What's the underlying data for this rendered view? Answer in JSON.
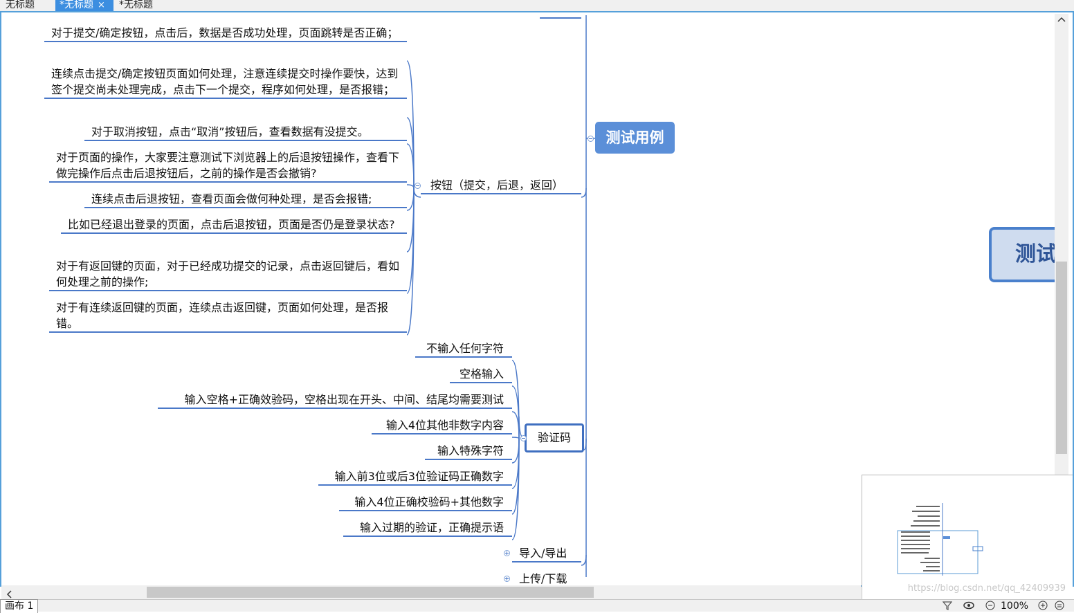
{
  "tabs": [
    {
      "label": "无标题"
    },
    {
      "label": "*无标题"
    },
    {
      "label": "*无标题"
    }
  ],
  "tab_close_glyph": "×",
  "mindmap": {
    "root": "测试",
    "topic": "测试用例",
    "button_branch": {
      "label": "按钮（提交，后退，返回）",
      "items": [
        "对于提交/确定按钮，点击后，数据是否成功处理，页面跳转是否正确；",
        "连续点击提交/确定按钮页面如何处理，注意连续提交时操作要快，达到签个提交尚未处理完成，点击下一个提交，程序如何处理，是否报错；",
        "对于取消按钮，点击“取消”按钮后，查看数据有没提交。",
        "对于页面的操作，大家要注意测试下浏览器上的后退按钮操作，查看下做完操作后点击后退按钮后，之前的操作是否会撤销?",
        "连续点击后退按钮，查看页面会做何种处理，是否会报错;",
        "比如已经退出登录的页面，点击后退按钮，页面是否仍是登录状态?",
        "对于有返回键的页面，对于已经成功提交的记录，点击返回键后，看如何处理之前的操作;",
        "对于有连续返回键的页面，连续点击返回键，页面如何处理，是否报错。"
      ]
    },
    "captcha_branch": {
      "label": "验证码",
      "items": [
        "不输入任何字符",
        "空格输入",
        "输入空格+正确效验码，空格出现在开头、中间、结尾均需要测试",
        "输入4位其他非数字内容",
        "输入特殊字符",
        "输入前3位或后3位验证码正确数字",
        "输入4位正确校验码+其他数字",
        "输入过期的验证，正确提示语"
      ]
    },
    "collapsed": [
      "导入/导出",
      "上传/下载"
    ]
  },
  "watermark": "https://blog.csdn.net/qq_42409939",
  "status": {
    "sheet": "画布 1",
    "zoom": "100%"
  }
}
